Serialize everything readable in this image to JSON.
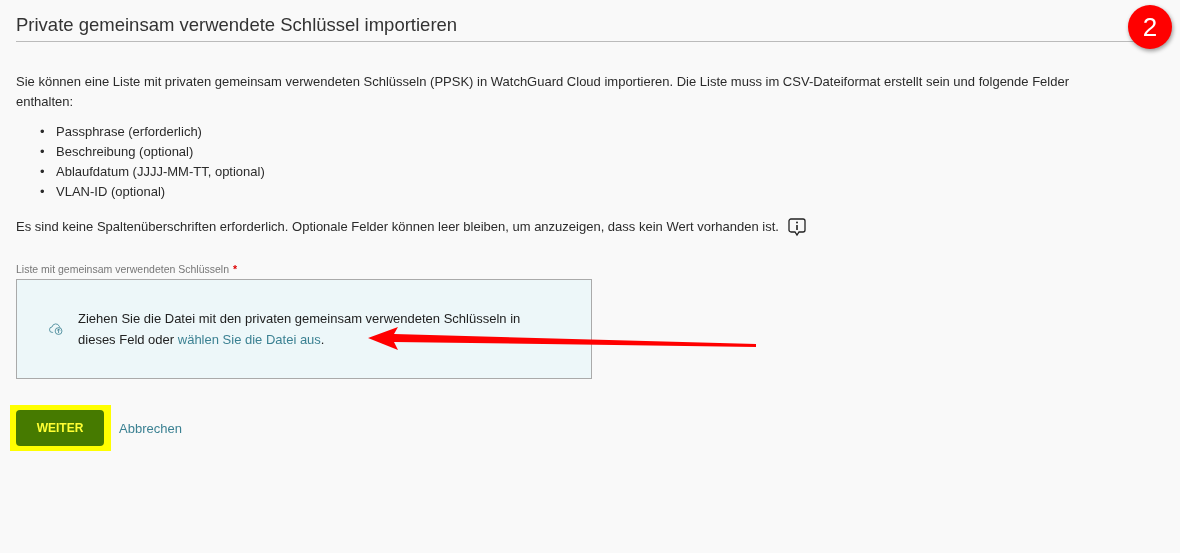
{
  "heading": "Private gemeinsam verwendete Schlüssel importieren",
  "step_badge": "2",
  "intro": "Sie können eine Liste mit privaten gemeinsam verwendeten Schlüsseln (PPSK) in WatchGuard Cloud importieren. Die Liste muss im CSV-Dateiformat erstellt sein und folgende Felder enthalten:",
  "fields": [
    {
      "bullet": "•",
      "text": "Passphrase (erforderlich)"
    },
    {
      "bullet": "•",
      "text": "Beschreibung (optional)"
    },
    {
      "bullet": "•",
      "text": "Ablaufdatum (JJJJ-MM-TT, optional)"
    },
    {
      "bullet": "•",
      "text": "VLAN-ID (optional)"
    }
  ],
  "note": "Es sind keine Spaltenüberschriften erforderlich. Optionale Felder können leer bleiben, um anzuzeigen, dass kein Wert vorhanden ist.",
  "upload": {
    "label": "Liste mit gemeinsam verwendeten Schlüsseln",
    "required_mark": "*",
    "text": "Ziehen Sie die Datei mit den privaten gemeinsam verwendeten Schlüsseln in dieses Feld oder ",
    "link": "wählen Sie die Datei aus",
    "after": "."
  },
  "buttons": {
    "primary": "WEITER",
    "cancel": "Abbrechen"
  }
}
